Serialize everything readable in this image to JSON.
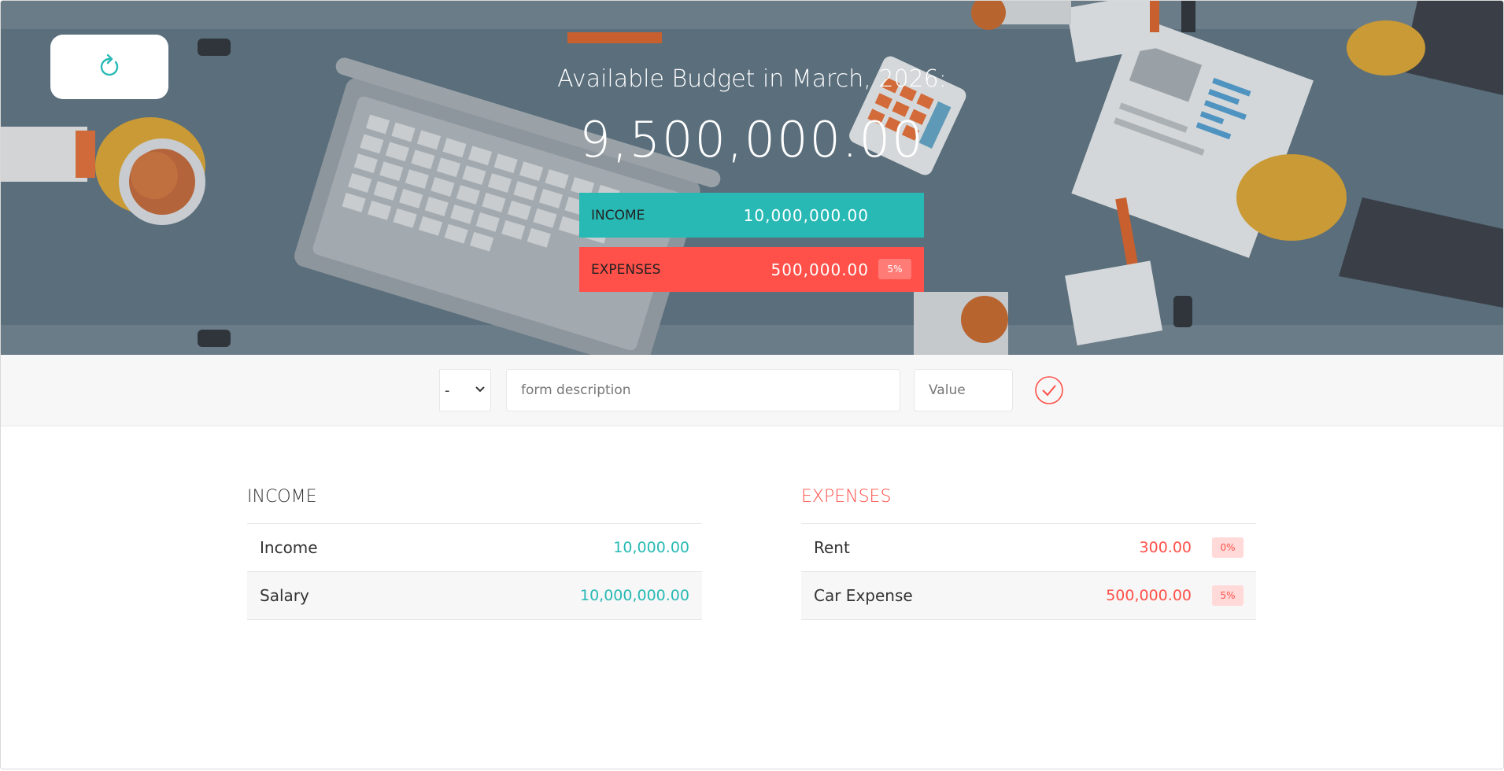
{
  "header": {
    "refresh_icon": "refresh-icon",
    "title": "Available Budget in March, 2026:",
    "budget": "9,500,000.00",
    "income_label": "INCOME",
    "income_value": "10,000,000.00",
    "expenses_label": "EXPENSES",
    "expenses_value": "500,000.00",
    "expenses_percent": "5%"
  },
  "add_form": {
    "type_selected": "-",
    "description_placeholder": "form description",
    "value_placeholder": "Value",
    "submit_icon": "checkmark-circle-icon"
  },
  "income": {
    "title": "INCOME",
    "items": [
      {
        "description": "Income",
        "value": "10,000.00"
      },
      {
        "description": "Salary",
        "value": "10,000,000.00"
      }
    ]
  },
  "expenses": {
    "title": "EXPENSES",
    "items": [
      {
        "description": "Rent",
        "value": "300.00",
        "percent": "0%"
      },
      {
        "description": "Car Expense",
        "value": "500,000.00",
        "percent": "5%"
      }
    ]
  },
  "colors": {
    "income": "#28b9b5",
    "expenses": "#ff5049",
    "hero_bg": "#5a6e7c"
  }
}
